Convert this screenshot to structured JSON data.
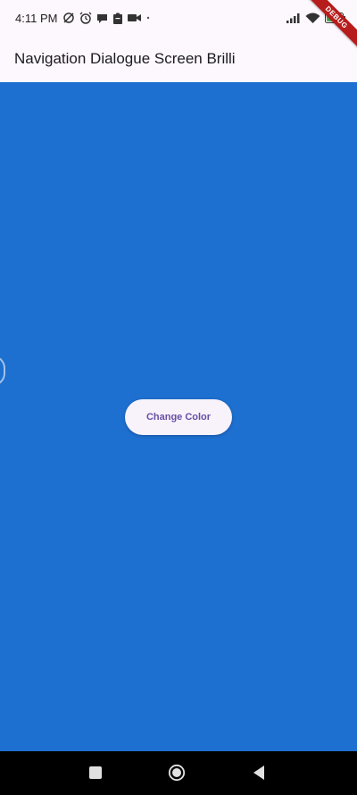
{
  "status_bar": {
    "time": "4:11 PM",
    "battery_level": "full",
    "left_icons": [
      "data-saver-icon",
      "alarm-icon",
      "chat-bubble-icon",
      "clipboard-icon",
      "video-camera-icon",
      "dot-icon"
    ],
    "right_icons": [
      "signal-icon",
      "wifi-icon",
      "battery-icon"
    ]
  },
  "debug_banner": {
    "label": "DEBUG",
    "color": "#b71c1c"
  },
  "app_bar": {
    "title": "Navigation Dialogue Screen Brilli",
    "background": "#fdf7fe"
  },
  "main": {
    "background": "#1d6fd0",
    "button_label": "Change Color",
    "button_text_color": "#6750a4"
  },
  "nav_bar": {
    "buttons": [
      "recent-apps-icon",
      "home-icon",
      "back-icon"
    ]
  }
}
